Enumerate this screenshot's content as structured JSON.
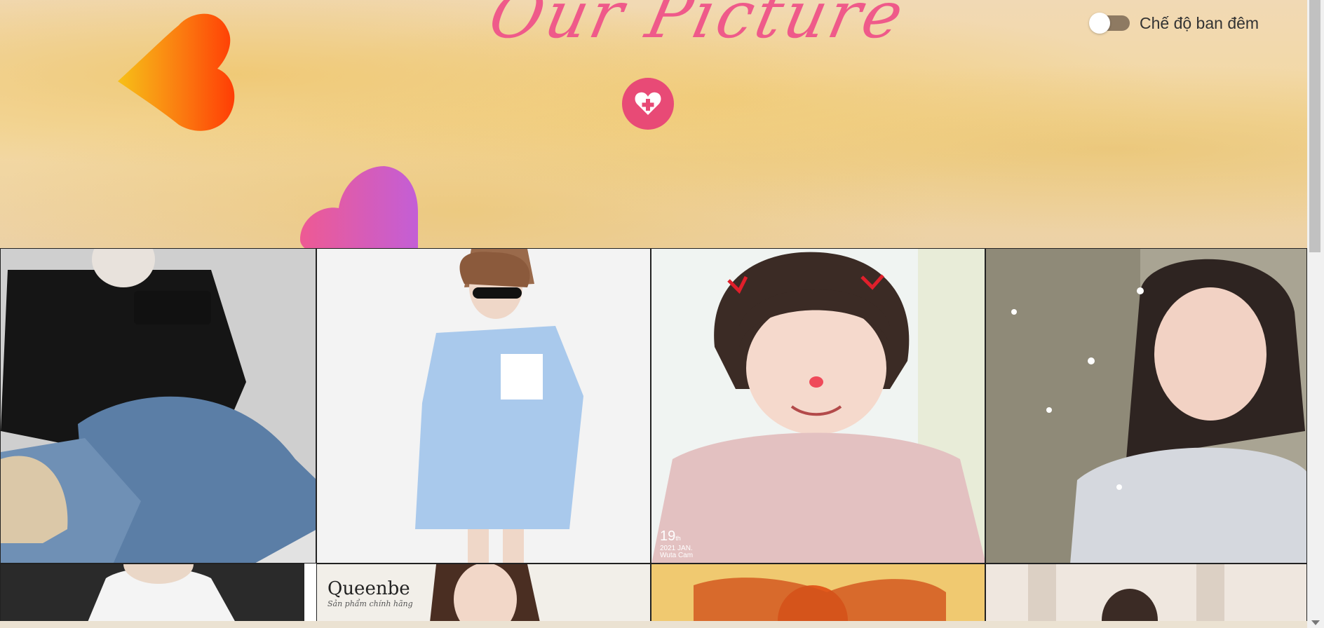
{
  "header": {
    "title": "Our Picture",
    "add_button_icon": "heart-plus-icon",
    "dark_mode_label": "Chế độ ban đêm",
    "dark_mode_on": false
  },
  "gallery": {
    "photos": [
      {
        "name": "photo-man-black-shirt-jeans"
      },
      {
        "name": "photo-woman-blue-shirt-dress"
      },
      {
        "name": "photo-girl-cat-filter"
      },
      {
        "name": "photo-girl-sparkles"
      },
      {
        "name": "photo-man-white-tshirt"
      },
      {
        "name": "photo-queenbe-model"
      },
      {
        "name": "photo-autumn-sunset"
      },
      {
        "name": "photo-girl-curtain"
      }
    ],
    "stamp_day": "19",
    "stamp_suffix": "th",
    "stamp_date": "2021 JAN.",
    "stamp_brand": "Wuta Cam",
    "queenbe_logo": "Queenbe",
    "queenbe_tagline": "Sản phẩm chính hãng"
  },
  "colors": {
    "title": "#ef5a8a",
    "add_button": "#e84a76",
    "toggle_track": "#8e7a62"
  }
}
